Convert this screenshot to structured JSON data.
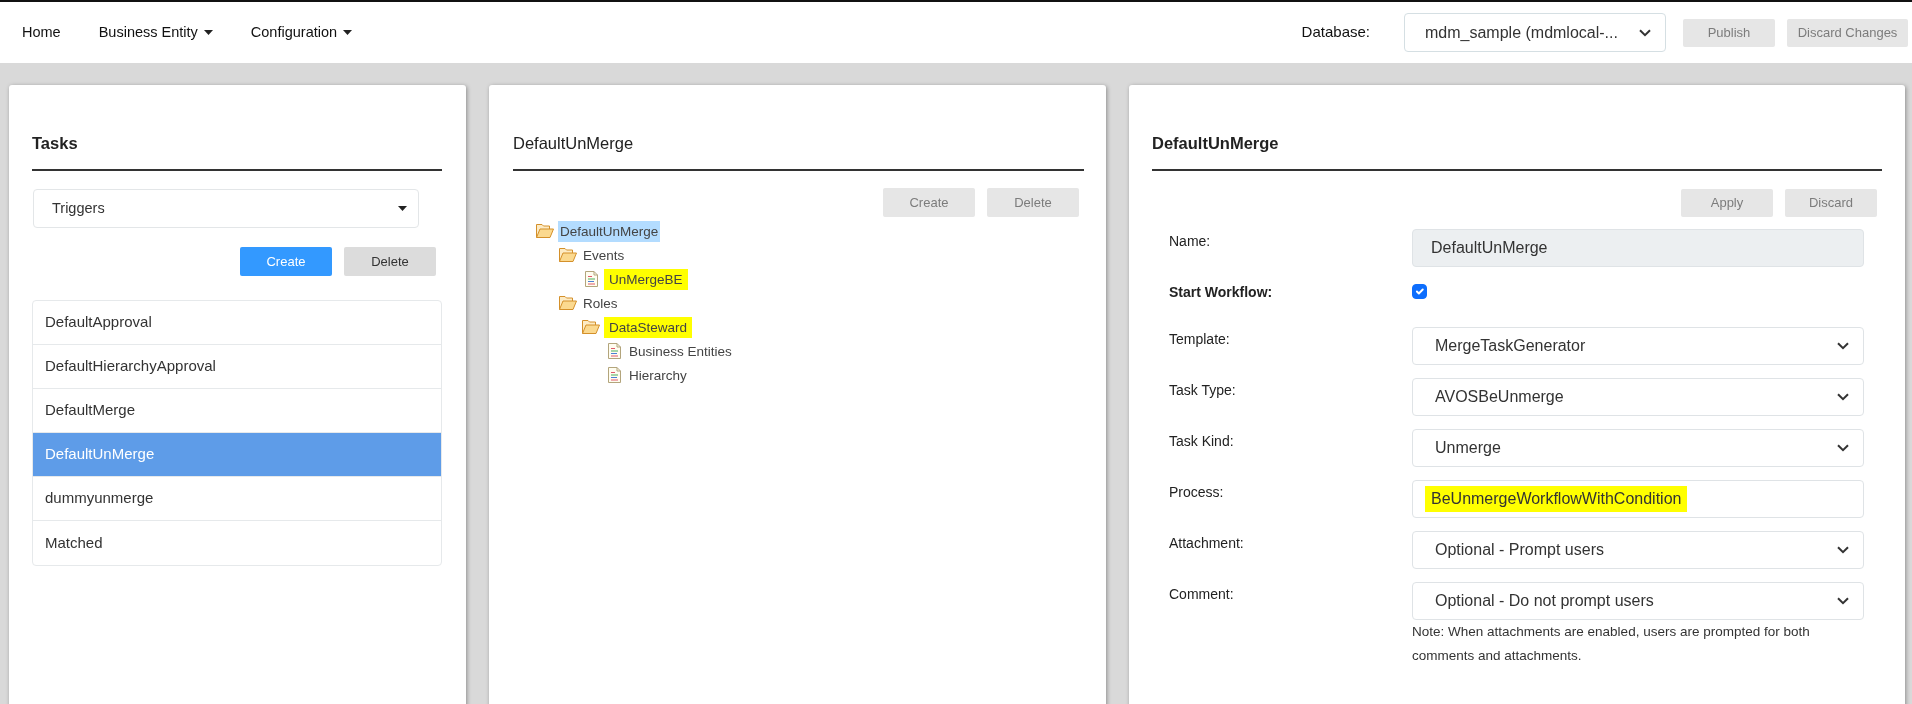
{
  "navbar": {
    "menu": [
      {
        "label": "Home",
        "dropdown": false
      },
      {
        "label": "Business Entity",
        "dropdown": true
      },
      {
        "label": "Configuration",
        "dropdown": true
      }
    ],
    "database_label": "Database:",
    "database_value": "mdm_sample (mdmlocal-...",
    "buttons": [
      {
        "label": "Publish",
        "disabled": true
      },
      {
        "label": "Discard Changes",
        "disabled": true
      }
    ]
  },
  "tasks_panel": {
    "title": "Tasks",
    "filter": "Triggers",
    "buttons": [
      {
        "label": "Create",
        "kind": "primary",
        "disabled": false
      },
      {
        "label": "Delete",
        "kind": "secondary",
        "disabled": false
      }
    ],
    "items": [
      {
        "label": "DefaultApproval",
        "selected": false
      },
      {
        "label": "DefaultHierarchyApproval",
        "selected": false
      },
      {
        "label": "DefaultMerge",
        "selected": false
      },
      {
        "label": "DefaultUnMerge",
        "selected": true
      },
      {
        "label": "dummyunmerge",
        "selected": false
      },
      {
        "label": "Matched",
        "selected": false
      }
    ]
  },
  "tree_panel": {
    "title": "DefaultUnMerge",
    "buttons": [
      {
        "label": "Create",
        "disabled": true
      },
      {
        "label": "Delete",
        "disabled": true
      }
    ],
    "tree": [
      {
        "label": "DefaultUnMerge",
        "kind": "folder",
        "selected": true,
        "highlighted": false,
        "children": [
          {
            "label": "Events",
            "kind": "folder",
            "selected": false,
            "highlighted": false,
            "children": [
              {
                "label": "UnMergeBE",
                "kind": "document",
                "selected": false,
                "highlighted": true
              }
            ]
          },
          {
            "label": "Roles",
            "kind": "folder",
            "selected": false,
            "highlighted": false,
            "children": [
              {
                "label": "DataSteward",
                "kind": "folder",
                "selected": false,
                "highlighted": true,
                "children": [
                  {
                    "label": "Business Entities",
                    "kind": "document",
                    "selected": false,
                    "highlighted": false
                  },
                  {
                    "label": "Hierarchy",
                    "kind": "document",
                    "selected": false,
                    "highlighted": false
                  }
                ]
              }
            ]
          }
        ]
      }
    ]
  },
  "details_panel": {
    "title": "DefaultUnMerge",
    "buttons": [
      {
        "label": "Apply",
        "disabled": true
      },
      {
        "label": "Discard",
        "disabled": true
      }
    ],
    "fields": [
      {
        "label": "Name:",
        "kind": "text",
        "value": "DefaultUnMerge",
        "disabled": true,
        "highlighted": false
      },
      {
        "label": "Start Workflow:",
        "kind": "checkbox",
        "checked": true
      },
      {
        "label": "Template:",
        "kind": "select",
        "value": "MergeTaskGenerator"
      },
      {
        "label": "Task Type:",
        "kind": "select",
        "value": "AVOSBeUnmerge"
      },
      {
        "label": "Task Kind:",
        "kind": "select",
        "value": "Unmerge"
      },
      {
        "label": "Process:",
        "kind": "text",
        "value": "BeUnmergeWorkflowWithCondition",
        "disabled": false,
        "highlighted": true
      },
      {
        "label": "Attachment:",
        "kind": "select",
        "value": "Optional - Prompt users"
      },
      {
        "label": "Comment:",
        "kind": "select",
        "value": "Optional - Do not prompt users"
      }
    ],
    "note": "Note: When attachments are enabled, users are prompted for both comments and attachments."
  }
}
